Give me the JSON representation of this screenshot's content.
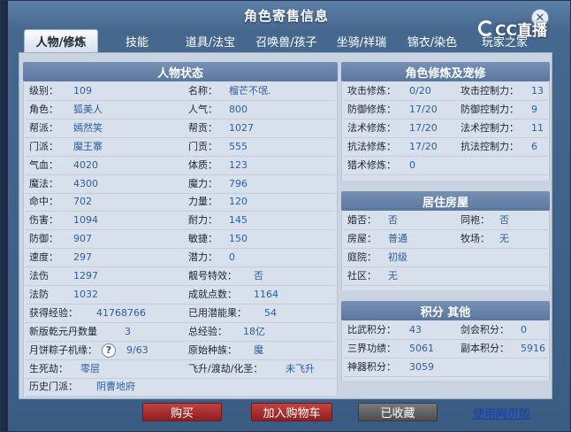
{
  "window": {
    "title": "角色寄售信息",
    "close_glyph": "✕"
  },
  "logo": {
    "text": "CC直播"
  },
  "tabs": [
    {
      "label": "人物/修炼",
      "active": true
    },
    {
      "label": "技能"
    },
    {
      "label": "道具/法宝"
    },
    {
      "label": "召唤兽/孩子"
    },
    {
      "label": "坐骑/祥瑞"
    },
    {
      "label": "锦衣/染色"
    },
    {
      "label": "玩家之家"
    }
  ],
  "status": {
    "title": "人物状态",
    "left": [
      {
        "label": "级别：",
        "value": "109"
      },
      {
        "label": "角色：",
        "value": "狐美人"
      },
      {
        "label": "帮派：",
        "value": "嫣然笑"
      },
      {
        "label": "门派：",
        "value": "魔王寨"
      },
      {
        "label": "气血：",
        "value": "4020"
      },
      {
        "label": "魔法：",
        "value": "4300"
      },
      {
        "label": "命中：",
        "value": "702"
      },
      {
        "label": "伤害：",
        "value": "1094"
      },
      {
        "label": "防御：",
        "value": "907"
      },
      {
        "label": "速度：",
        "value": "297"
      },
      {
        "label": "法伤",
        "value": "1297"
      },
      {
        "label": "法防",
        "value": "1032"
      },
      {
        "label": "获得经验：",
        "value": "41768766"
      },
      {
        "label": "新版乾元丹数量",
        "value": "3"
      },
      {
        "label": "月饼粽子机缘：",
        "value": "9/63"
      },
      {
        "label": "生死劫：",
        "value": "零层"
      },
      {
        "label": "历史门派：",
        "value": "阴曹地府"
      }
    ],
    "right": [
      {
        "label": "名称：",
        "value": "榴芒不氓."
      },
      {
        "label": "人气：",
        "value": "800"
      },
      {
        "label": "帮贡：",
        "value": "1027"
      },
      {
        "label": "门贡：",
        "value": "555"
      },
      {
        "label": "体质：",
        "value": "123"
      },
      {
        "label": "魔力：",
        "value": "796"
      },
      {
        "label": "力量：",
        "value": "120"
      },
      {
        "label": "耐力：",
        "value": "145"
      },
      {
        "label": "敏捷：",
        "value": "150"
      },
      {
        "label": "潜力：",
        "value": "0"
      },
      {
        "label": "靓号特效：",
        "value": "否"
      },
      {
        "label": "成就点数：",
        "value": "1164"
      },
      {
        "label": "已用潜能果：",
        "value": "54"
      },
      {
        "label": "总经验：",
        "value": "18亿"
      },
      {
        "label": "原始种族：",
        "value": "魔"
      },
      {
        "label": "飞升/渡劫/化圣：",
        "value": "未飞升"
      }
    ],
    "help_glyph": "?"
  },
  "cultivation": {
    "title": "角色修炼及宠修",
    "rows": [
      {
        "l1": "攻击修炼：",
        "v1": "0/20",
        "l2": "攻击控制力：",
        "v2": "13"
      },
      {
        "l1": "防御修炼：",
        "v1": "17/20",
        "l2": "防御控制力：",
        "v2": "9"
      },
      {
        "l1": "法术修炼：",
        "v1": "17/20",
        "l2": "法术控制力：",
        "v2": "11"
      },
      {
        "l1": "抗法修炼：",
        "v1": "17/20",
        "l2": "抗法控制力：",
        "v2": "6"
      },
      {
        "l1": "猎术修炼：",
        "v1": "0",
        "l2": "",
        "v2": ""
      }
    ]
  },
  "housing": {
    "title": "居住房屋",
    "rows": [
      {
        "l1": "婚否：",
        "v1": "否",
        "l2": "同袍：",
        "v2": "否"
      },
      {
        "l1": "房屋：",
        "v1": "普通",
        "l2": "牧场：",
        "v2": "无"
      },
      {
        "l1": "庭院：",
        "v1": "初级",
        "l2": "",
        "v2": ""
      },
      {
        "l1": "社区：",
        "v1": "无",
        "l2": "",
        "v2": ""
      }
    ]
  },
  "points": {
    "title": "积分 其他",
    "rows": [
      {
        "l1": "比武积分：",
        "v1": "43",
        "l2": "剑会积分：",
        "v2": "0"
      },
      {
        "l1": "三界功绩：",
        "v1": "5061",
        "l2": "副本积分：",
        "v2": "5916"
      },
      {
        "l1": "神器积分：",
        "v1": "3059",
        "l2": "",
        "v2": ""
      }
    ]
  },
  "footer": {
    "buy": "购买",
    "add_cart": "加入购物车",
    "collected": "已收藏",
    "web_link": "使用网页版"
  }
}
